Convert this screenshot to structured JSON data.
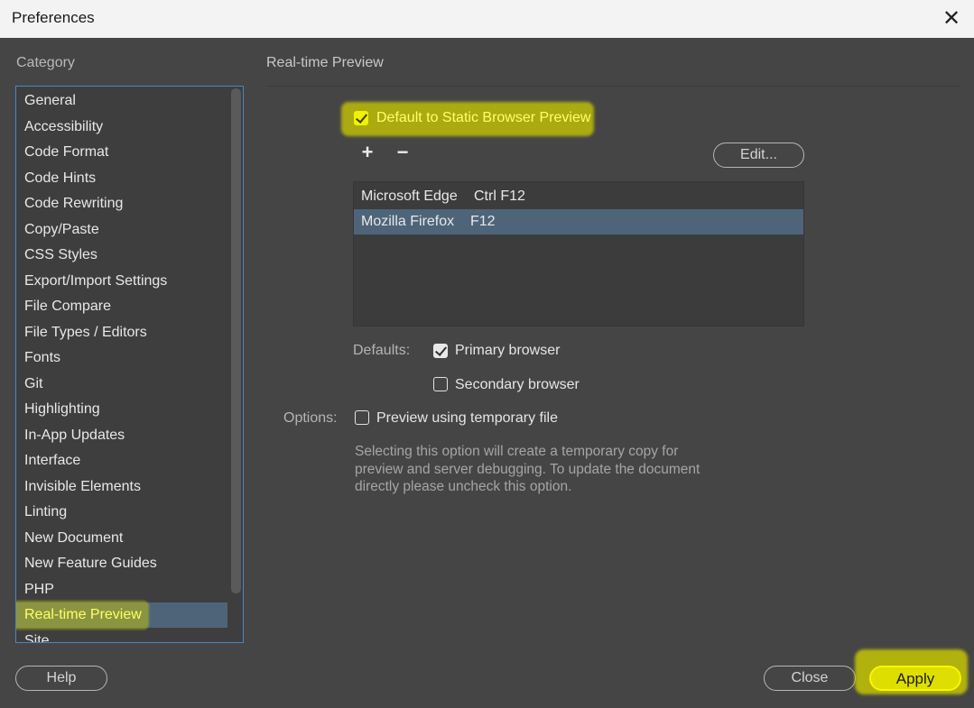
{
  "window": {
    "title": "Preferences"
  },
  "category": {
    "label": "Category",
    "items": [
      "General",
      "Accessibility",
      "Code Format",
      "Code Hints",
      "Code Rewriting",
      "Copy/Paste",
      "CSS Styles",
      "Export/Import Settings",
      "File Compare",
      "File Types / Editors",
      "Fonts",
      "Git",
      "Highlighting",
      "In-App Updates",
      "Interface",
      "Invisible Elements",
      "Linting",
      "New Document",
      "New Feature Guides",
      "PHP",
      "Real-time Preview",
      "Site"
    ],
    "selected": "Real-time Preview"
  },
  "panel": {
    "title": "Real-time Preview",
    "default_static_label": "Default to Static Browser Preview",
    "default_static_checked": true,
    "add_icon": "+",
    "remove_icon": "−",
    "edit_label": "Edit...",
    "browsers": [
      {
        "name": "Microsoft Edge",
        "shortcut": "Ctrl F12"
      },
      {
        "name": "Mozilla Firefox",
        "shortcut": "F12"
      }
    ],
    "selected_browser": "Mozilla Firefox",
    "defaults_label": "Defaults:",
    "primary_label": "Primary browser",
    "primary_checked": true,
    "secondary_label": "Secondary browser",
    "secondary_checked": false,
    "options_label": "Options:",
    "temp_file_label": "Preview using temporary file",
    "temp_file_checked": false,
    "description": "Selecting this option will create a temporary copy for preview and server debugging. To update the document directly please uncheck this option."
  },
  "footer": {
    "help_label": "Help",
    "close_label": "Close",
    "apply_label": "Apply"
  },
  "colors": {
    "background": "#454545",
    "selection": "#4e6479",
    "highlight": "#e0e000",
    "list_border": "#4a86c7"
  }
}
